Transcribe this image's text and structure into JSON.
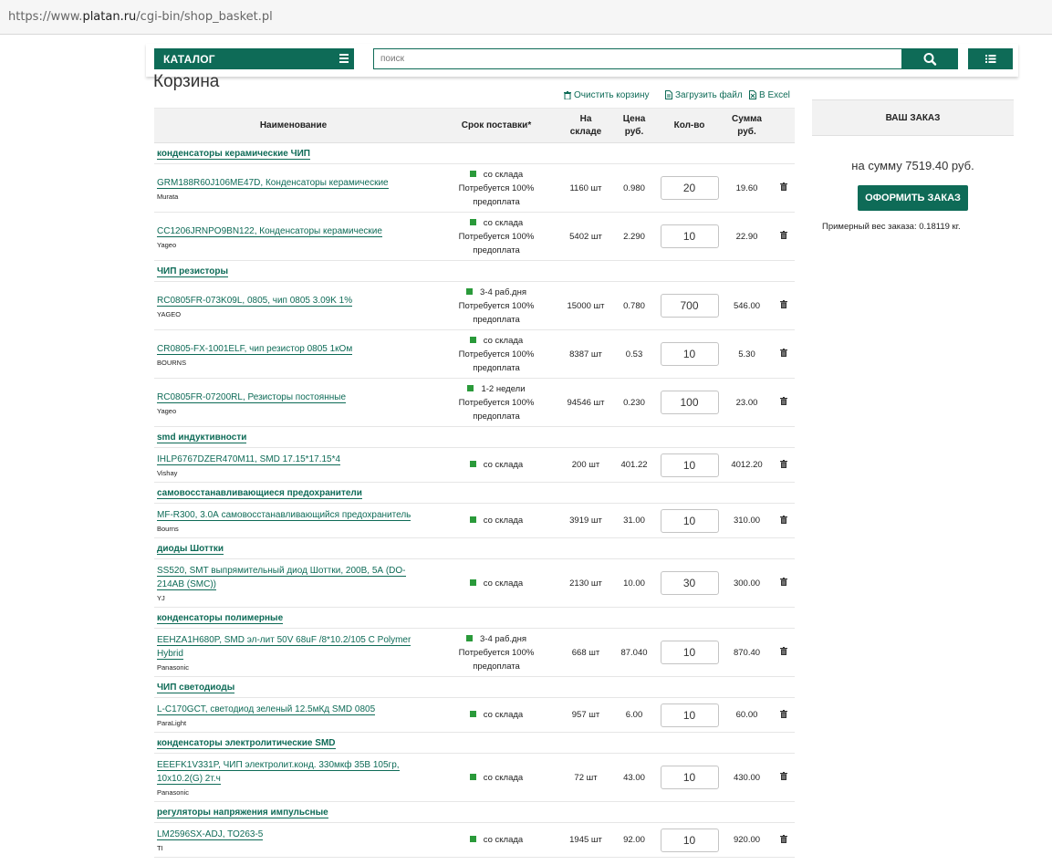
{
  "browser": {
    "url_prefix": "https://www.",
    "url_host": "platan.ru",
    "url_path": "/cgi-bin/shop_basket.pl"
  },
  "header": {
    "catalog_label": "КАТАЛОГ",
    "search_placeholder": "поиск"
  },
  "page": {
    "title": "Корзина"
  },
  "actions": {
    "clear": "Очистить корзину",
    "upload": "Загрузить файл",
    "excel": "В Excel"
  },
  "table": {
    "headers": {
      "name": "Наименование",
      "delivery": "Срок поставки*",
      "stock_1": "На",
      "stock_2": "складе",
      "price_1": "Цена",
      "price_2": "руб.",
      "qty": "Кол-во",
      "sum_1": "Сумма",
      "sum_2": "руб."
    },
    "rows": [
      {
        "type": "category",
        "label": "конденсаторы керамические ЧИП"
      },
      {
        "type": "item",
        "name": "GRM188R60J106ME47D, Конденсаторы керамические",
        "brand": "Murata",
        "delivery": "со склада",
        "note1": "Потребуется 100%",
        "note2": "предоплата",
        "stock": "1160 шт",
        "price": "0.980",
        "qty": "20",
        "sum": "19.60"
      },
      {
        "type": "item",
        "name": "CC1206JRNPO9BN122, Конденсаторы керамические",
        "brand": "Yageo",
        "delivery": "со склада",
        "note1": "Потребуется 100%",
        "note2": "предоплата",
        "stock": "5402 шт",
        "price": "2.290",
        "qty": "10",
        "sum": "22.90"
      },
      {
        "type": "category",
        "label": "ЧИП резисторы"
      },
      {
        "type": "item",
        "name": "RC0805FR-073K09L, 0805, чип 0805 3.09K 1%",
        "brand": "YAGEO",
        "delivery": "3-4 раб.дня",
        "note1": "Потребуется 100%",
        "note2": "предоплата",
        "stock": "15000 шт",
        "price": "0.780",
        "qty": "700",
        "sum": "546.00"
      },
      {
        "type": "item",
        "name": "CR0805-FX-1001ELF, чип резистор 0805 1кОм",
        "brand": "BOURNS",
        "delivery": "со склада",
        "note1": "Потребуется 100%",
        "note2": "предоплата",
        "stock": "8387 шт",
        "price": "0.53",
        "qty": "10",
        "sum": "5.30"
      },
      {
        "type": "item",
        "name": "RC0805FR-07200RL, Резисторы постоянные",
        "brand": "Yageo",
        "delivery": "1-2 недели",
        "note1": "Потребуется 100%",
        "note2": "предоплата",
        "stock": "94546 шт",
        "price": "0.230",
        "qty": "100",
        "sum": "23.00"
      },
      {
        "type": "category",
        "label": "smd индуктивности"
      },
      {
        "type": "item",
        "name": "IHLP6767DZER470M11, SMD 17.15*17.15*4",
        "brand": "Vishay",
        "delivery": "со склада",
        "note1": "",
        "note2": "",
        "stock": "200 шт",
        "price": "401.22",
        "qty": "10",
        "sum": "4012.20"
      },
      {
        "type": "category",
        "label": "самовосстанавливающиеся предохранители"
      },
      {
        "type": "item",
        "name": "MF-R300, 3.0А самовосстанавливающийся предохранитель",
        "brand": "Bourns",
        "delivery": "со склада",
        "note1": "",
        "note2": "",
        "stock": "3919 шт",
        "price": "31.00",
        "qty": "10",
        "sum": "310.00"
      },
      {
        "type": "category",
        "label": "диоды Шоттки"
      },
      {
        "type": "item",
        "name": "SS520, SMT выпрямительный диод Шоттки, 200В, 5А (DO-214AB (SMC))",
        "brand": "YJ",
        "delivery": "со склада",
        "note1": "",
        "note2": "",
        "stock": "2130 шт",
        "price": "10.00",
        "qty": "30",
        "sum": "300.00"
      },
      {
        "type": "category",
        "label": "конденсаторы полимерные"
      },
      {
        "type": "item",
        "name": "EEHZA1H680P, SMD эл-лит 50V 68uF /8*10.2/105 C Polymer Hybrid",
        "brand": "Panasonic",
        "delivery": "3-4 раб.дня",
        "note1": "Потребуется 100%",
        "note2": "предоплата",
        "stock": "668 шт",
        "price": "87.040",
        "qty": "10",
        "sum": "870.40"
      },
      {
        "type": "category",
        "label": "ЧИП светодиоды"
      },
      {
        "type": "item",
        "name": "L-C170GCT, светодиод зеленый 12.5мКд SMD 0805",
        "brand": "ParaLight",
        "delivery": "со склада",
        "note1": "",
        "note2": "",
        "stock": "957 шт",
        "price": "6.00",
        "qty": "10",
        "sum": "60.00"
      },
      {
        "type": "category",
        "label": "конденсаторы электролитические SMD"
      },
      {
        "type": "item",
        "name": "EEEFK1V331P, ЧИП электролит.конд. 330мкф 35В 105гр, 10x10.2(G) 2т.ч",
        "brand": "Panasonic",
        "delivery": "со склада",
        "note1": "",
        "note2": "",
        "stock": "72 шт",
        "price": "43.00",
        "qty": "10",
        "sum": "430.00"
      },
      {
        "type": "category",
        "label": "регуляторы напряжения импульсные"
      },
      {
        "type": "item",
        "name": "LM2596SX-ADJ, TO263-5",
        "brand": "TI",
        "delivery": "со склада",
        "note1": "",
        "note2": "",
        "stock": "1945 шт",
        "price": "92.00",
        "qty": "10",
        "sum": "920.00"
      }
    ]
  },
  "order": {
    "title": "ВАШ ЗАКАЗ",
    "sum_text": "на сумму 7519.40 руб.",
    "button": "ОФОРМИТЬ ЗАКАЗ",
    "weight_text": "Примерный вес заказа: 0.18119 кг."
  },
  "colors": {
    "accent": "#0e6b57",
    "in_stock": "#2a9a3a"
  },
  "icons": {
    "catalog": "hamburger-icon",
    "search": "search-icon",
    "list": "list-icon",
    "clear": "trash-icon",
    "upload": "file-icon",
    "excel": "excel-icon",
    "row_delete": "trash-icon"
  }
}
